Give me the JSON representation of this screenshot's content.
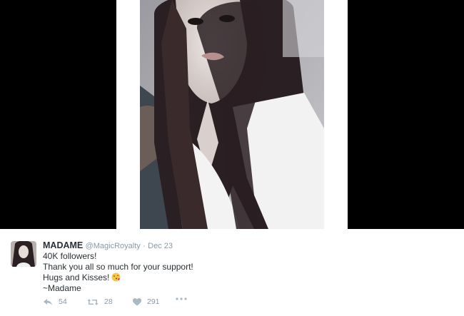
{
  "tweet": {
    "display_name": "MADAME",
    "handle": "@MagicRoyalty",
    "separator": "·",
    "date": "Dec 23",
    "lines": [
      "40K followers!",
      "Thank you all so much for your support!",
      "Hugs and Kisses!",
      "~Madame"
    ],
    "emoji": "face-throwing-kiss",
    "actions": {
      "reply_count": "54",
      "retweet_count": "28",
      "like_count": "291"
    }
  },
  "colors": {
    "media_background": "#000000",
    "text": "#292f33",
    "muted": "#8899a6"
  },
  "icons": [
    "reply-icon",
    "retweet-icon",
    "heart-icon",
    "more-icon"
  ]
}
